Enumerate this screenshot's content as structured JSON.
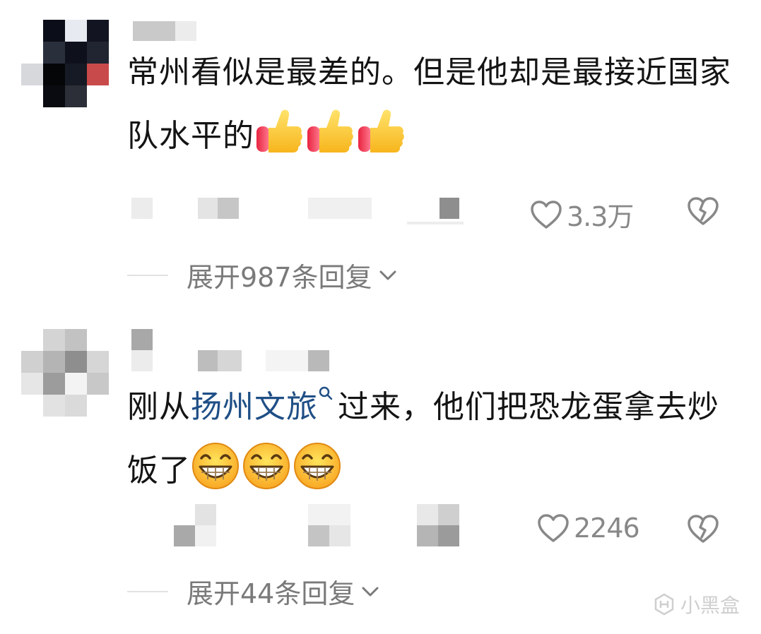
{
  "comments": [
    {
      "text": "常州看似是最差的。但是他却是最接近国家队水平的",
      "reactions": [
        "thumbs-up",
        "thumbs-up",
        "thumbs-up"
      ],
      "like_count": "3.3万",
      "expand_label": "展开987条回复"
    },
    {
      "text_before": "刚从",
      "link_text": "扬州文旅",
      "text_after": "过来，他们把恐龙蛋拿去炒饭了",
      "reactions": [
        "grinning-face",
        "grinning-face",
        "grinning-face"
      ],
      "like_count": "2246",
      "expand_label": "展开44条回复"
    }
  ],
  "watermark": {
    "text": "小黑盒"
  }
}
